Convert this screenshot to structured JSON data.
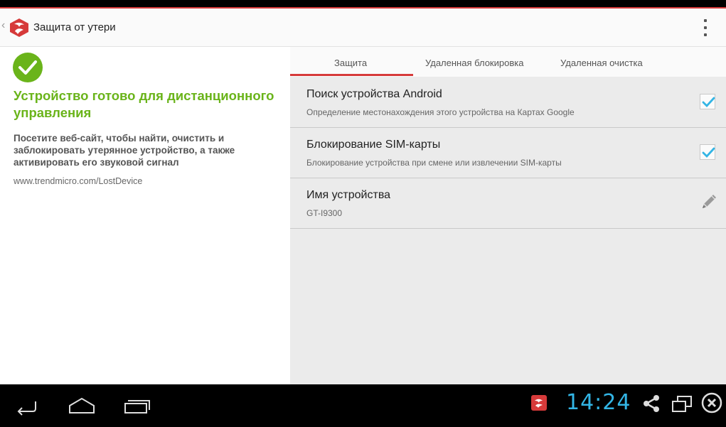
{
  "header": {
    "title": "Защита от утери",
    "back_glyph": "‹"
  },
  "left_panel": {
    "ready_title": "Устройство готово для дистанционного управления",
    "description": "Посетите веб-сайт, чтобы найти, очистить и заблокировать утерянное устройство, а также активировать его звуковой сигнал",
    "url": "www.trendmicro.com/LostDevice"
  },
  "tabs": [
    {
      "label": "Защита",
      "active": true
    },
    {
      "label": "Удаленная блокировка",
      "active": false
    },
    {
      "label": "Удаленная очистка",
      "active": false
    }
  ],
  "settings": [
    {
      "title": "Поиск устройства Android",
      "subtitle": "Определение местонахождения этого устройства на Картах Google",
      "control": "checkbox",
      "checked": true
    },
    {
      "title": "Блокирование SIM-карты",
      "subtitle": "Блокирование устройства при смене или извлечении SIM-карты",
      "control": "checkbox",
      "checked": true
    },
    {
      "title": "Имя устройства",
      "subtitle": "GT-I9300",
      "control": "edit-icon"
    }
  ],
  "system_bar": {
    "time": "14:24"
  },
  "colors": {
    "accent_red": "#d63a3a",
    "ready_green": "#6ab41a",
    "check_blue": "#33b5e5",
    "clock_blue": "#33b5e5"
  }
}
